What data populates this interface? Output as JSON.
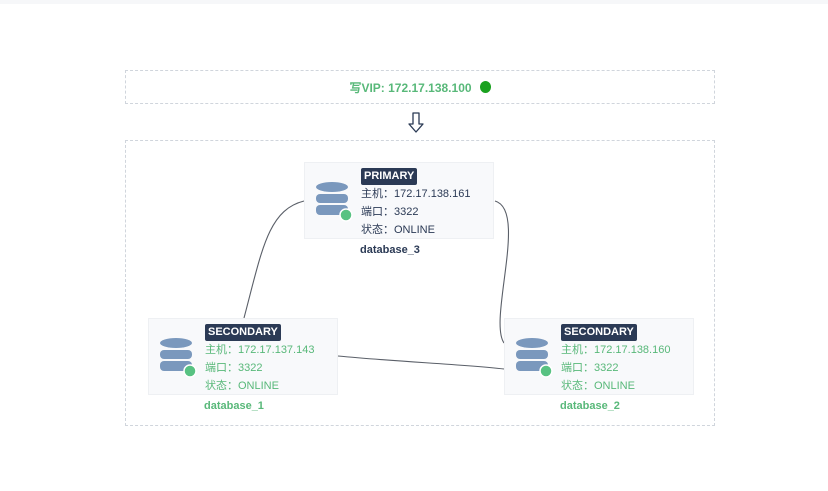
{
  "vip": {
    "text": "写VIP: 172.17.138.100",
    "status_color": "#1aa11f"
  },
  "colors": {
    "primary_text": "#2b3a55",
    "secondary_text": "#58b879",
    "badge_bg": "#2b3a55",
    "db_icon": "#7a98bd",
    "online_dot": "#58c282"
  },
  "nodes": [
    {
      "role": "PRIMARY",
      "host": "主机：172.17.138.161",
      "port": "端口：3322",
      "status": "状态：ONLINE",
      "name": "database_3"
    },
    {
      "role": "SECONDARY",
      "host": "主机：172.17.137.143",
      "port": "端口：3322",
      "status": "状态：ONLINE",
      "name": "database_1"
    },
    {
      "role": "SECONDARY",
      "host": "主机：172.17.138.160",
      "port": "端口：3322",
      "status": "状态：ONLINE",
      "name": "database_2"
    }
  ]
}
